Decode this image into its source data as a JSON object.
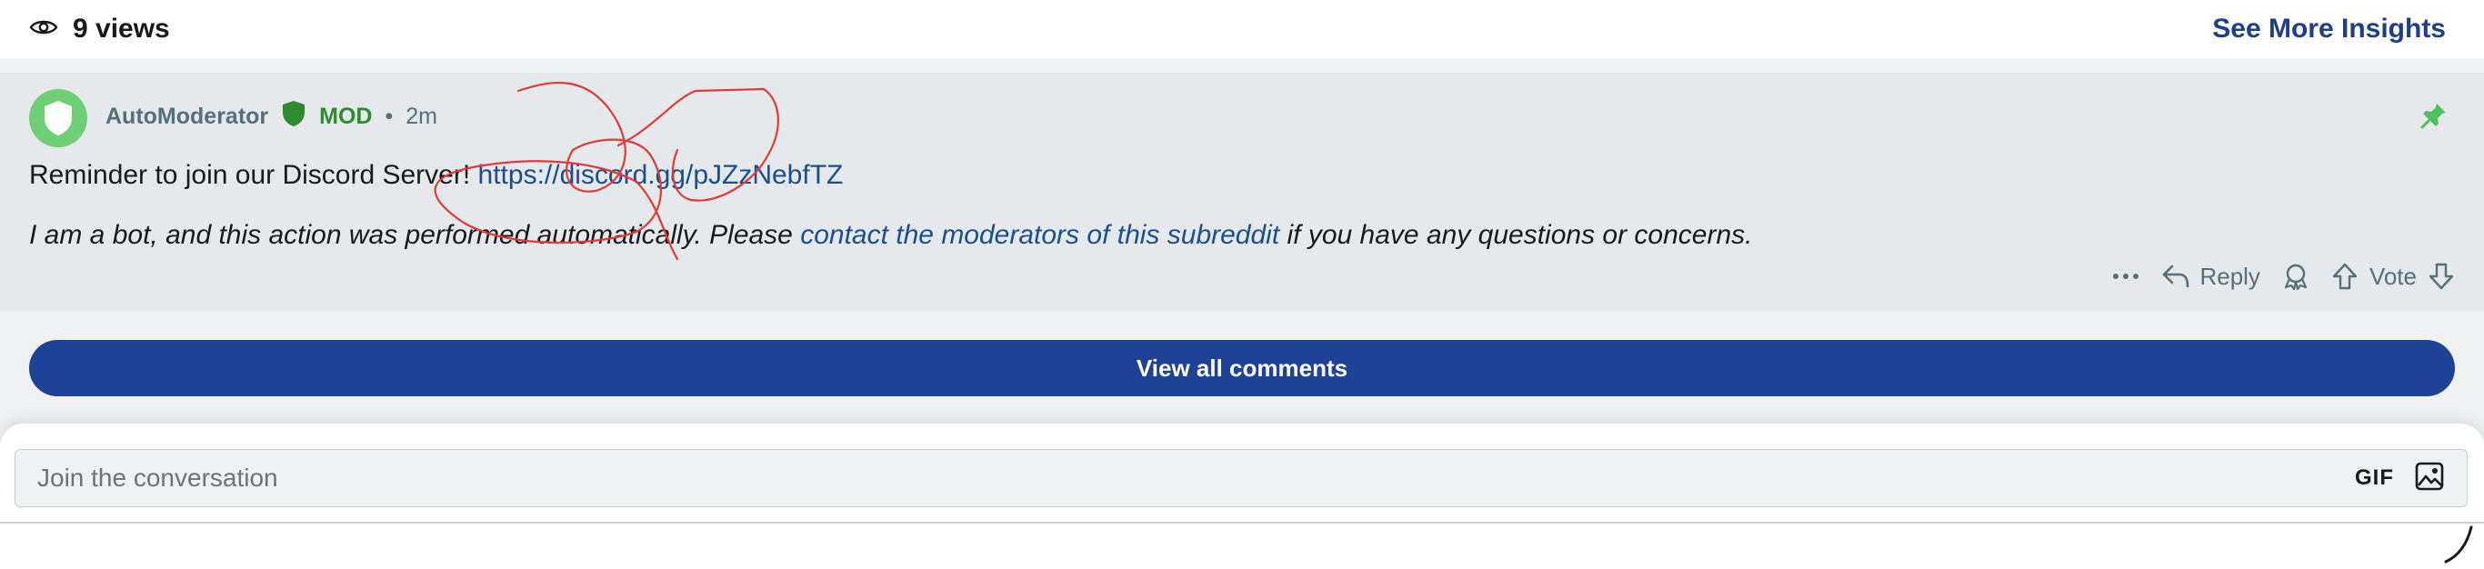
{
  "views": {
    "count_label": "9 views",
    "insights_label": "See More Insights"
  },
  "comment": {
    "author": "AutoModerator",
    "mod_label": "MOD",
    "separator": "•",
    "time": "2m",
    "line1_text": "Reminder to join our Discord Server!",
    "line1_link": "https://discord.gg/pJZzNebfTZ",
    "line2_before": "I am a bot, and this action was performed automatically. Please",
    "line2_link": "contact the moderators of this subreddit",
    "line2_after": "if you have any questions or concerns."
  },
  "actions": {
    "reply_label": "Reply",
    "vote_label": "Vote"
  },
  "view_all_label": "View all comments",
  "composer": {
    "placeholder": "Join the conversation",
    "gif_label": "GIF"
  },
  "colors": {
    "accent_blue": "#1e4296",
    "link_blue": "#1d4d8b",
    "mod_green": "#2e8b2e",
    "avatar_green": "#6fcf74",
    "pin_green": "#4cc25b",
    "annotation_red": "#e03a3a"
  }
}
